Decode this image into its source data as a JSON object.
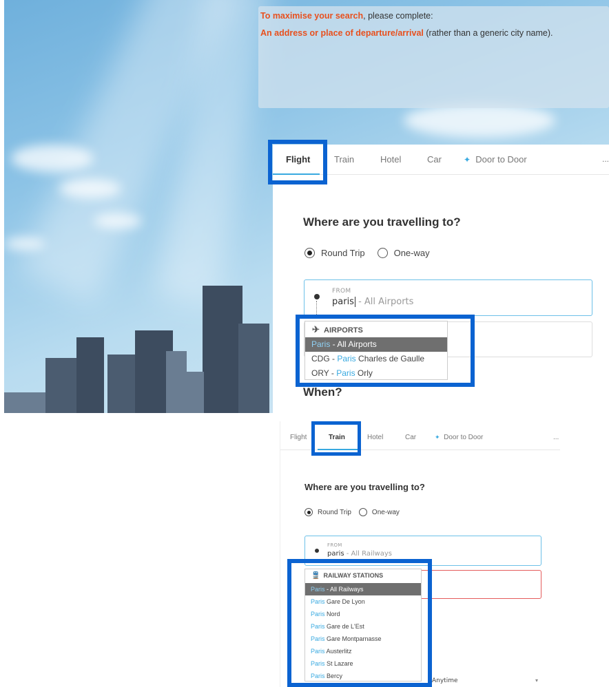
{
  "notice": {
    "line1_highlight": "To maximise your search",
    "line1_rest": ", please complete:",
    "line2_highlight": "An address or place of departure/arrival",
    "line2_rest": " (rather than a generic city name)."
  },
  "flight_panel": {
    "tabs": [
      "Flight",
      "Train",
      "Hotel",
      "Car",
      "Door to Door"
    ],
    "active_tab": "Flight",
    "more": "...",
    "heading": "Where are you travelling to?",
    "trip_types": [
      "Round Trip",
      "One-way"
    ],
    "selected_trip_type": "Round Trip",
    "from": {
      "label": "FROM",
      "value": "paris",
      "suffix": " - All Airports"
    },
    "when_heading": "When?",
    "dropdown": {
      "header": "AIRPORTS",
      "items": [
        {
          "code": "",
          "match": "Paris",
          "rest": " - All Airports",
          "selected": true
        },
        {
          "code": "CDG - ",
          "match": "Paris",
          "rest": " Charles de Gaulle",
          "selected": false
        },
        {
          "code": "ORY - ",
          "match": "Paris",
          "rest": " Orly",
          "selected": false
        }
      ]
    }
  },
  "train_panel": {
    "tabs": [
      "Flight",
      "Train",
      "Hotel",
      "Car",
      "Door to Door"
    ],
    "active_tab": "Train",
    "more": "...",
    "heading": "Where are you travelling to?",
    "trip_types": [
      "Round Trip",
      "One-way"
    ],
    "selected_trip_type": "Round Trip",
    "from": {
      "label": "FROM",
      "value": "paris",
      "suffix": " - All Railways"
    },
    "time_select": "Anytime",
    "dropdown": {
      "header": "RAILWAY STATIONS",
      "items": [
        {
          "match": "Paris",
          "rest": " - All Railways",
          "selected": true
        },
        {
          "match": "Paris",
          "rest": " Gare De Lyon",
          "selected": false
        },
        {
          "match": "Paris",
          "rest": " Nord",
          "selected": false
        },
        {
          "match": "Paris",
          "rest": " Gare de L'Est",
          "selected": false
        },
        {
          "match": "Paris",
          "rest": " Gare Montparnasse",
          "selected": false
        },
        {
          "match": "Paris",
          "rest": " Austerlitz",
          "selected": false
        },
        {
          "match": "Paris",
          "rest": " St Lazare",
          "selected": false
        },
        {
          "match": "Paris",
          "rest": " Bercy",
          "selected": false
        }
      ]
    }
  },
  "colors": {
    "accent": "#38a9e0",
    "highlight_box": "#0b63d1",
    "notice_highlight": "#e8501e",
    "error_border": "#e45b5b"
  },
  "icons": {
    "door_to_door": "sparkle-icon",
    "airports": "airplane-icon",
    "railway": "train-icon",
    "radio": "radio-button"
  }
}
